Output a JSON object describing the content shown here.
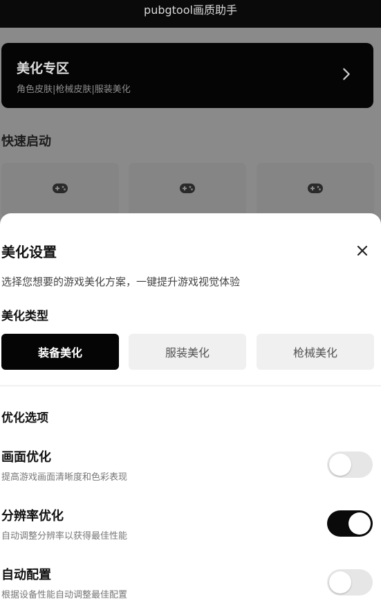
{
  "app": {
    "title": "pubgtool画质助手"
  },
  "beauty_card": {
    "title": "美化专区",
    "subtitle": "角色皮肤|枪械皮肤|服装美化"
  },
  "quick_start": {
    "title": "快速启动",
    "tiles": [
      "gamepad-icon",
      "gamepad-icon",
      "gamepad-icon"
    ]
  },
  "sheet": {
    "title": "美化设置",
    "description": "选择您想要的游戏美化方案，一键提升游戏视觉体验",
    "type_section": {
      "title": "美化类型",
      "options": [
        {
          "label": "装备美化",
          "selected": true
        },
        {
          "label": "服装美化",
          "selected": false
        },
        {
          "label": "枪械美化",
          "selected": false
        }
      ]
    },
    "optimization": {
      "title": "优化选项",
      "items": [
        {
          "label": "画面优化",
          "hint": "提高游戏画面清晰度和色彩表现",
          "enabled": false
        },
        {
          "label": "分辨率优化",
          "hint": "自动调整分辨率以获得最佳性能",
          "enabled": true
        },
        {
          "label": "自动配置",
          "hint": "根据设备性能自动调整最佳配置",
          "enabled": false
        }
      ]
    }
  },
  "colors": {
    "primary": "#050505",
    "toggle_off": "#e6e6e6",
    "button_inactive": "#f0f0f0"
  }
}
